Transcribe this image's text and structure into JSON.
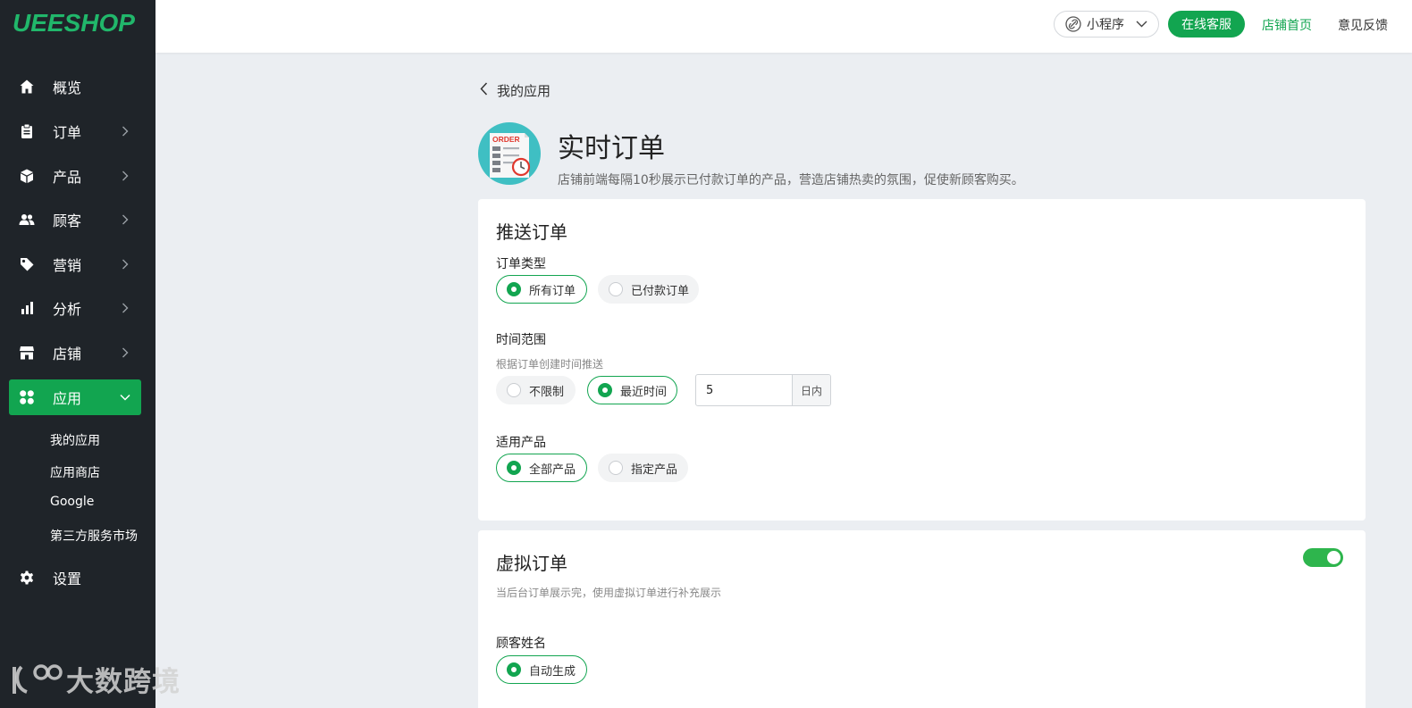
{
  "brand": {
    "logo_text": "UEESHOP",
    "accent": "#12a550"
  },
  "sidebar": {
    "items": [
      {
        "label": "概览",
        "icon": "home-icon",
        "has_chevron": false
      },
      {
        "label": "订单",
        "icon": "clipboard-icon",
        "has_chevron": true
      },
      {
        "label": "产品",
        "icon": "box-icon",
        "has_chevron": true
      },
      {
        "label": "顾客",
        "icon": "users-icon",
        "has_chevron": true
      },
      {
        "label": "营销",
        "icon": "tag-icon",
        "has_chevron": true
      },
      {
        "label": "分析",
        "icon": "bar-chart-icon",
        "has_chevron": true
      },
      {
        "label": "店铺",
        "icon": "store-icon",
        "has_chevron": true
      },
      {
        "label": "应用",
        "icon": "apps-grid-icon",
        "has_chevron": true,
        "active": true,
        "expanded": true
      }
    ],
    "sub_items": [
      {
        "label": "我的应用"
      },
      {
        "label": "应用商店"
      },
      {
        "label": "Google"
      },
      {
        "label": "第三方服务市场"
      }
    ],
    "settings": {
      "label": "设置",
      "icon": "gear-icon"
    }
  },
  "watermark": {
    "text": "大数跨境"
  },
  "topbar": {
    "mini_program": "小程序",
    "online_service": "在线客服",
    "shop_home": "店铺首页",
    "feedback": "意见反馈"
  },
  "header": {
    "back_label": "我的应用",
    "app_icon_text": "ORDER",
    "title": "实时订单",
    "description": "店铺前端每隔10秒展示已付款订单的产品，营造店铺热卖的氛围，促使新顾客购买。"
  },
  "push_orders": {
    "title": "推送订单",
    "order_type": {
      "label": "订单类型",
      "options": [
        {
          "label": "所有订单",
          "selected": true
        },
        {
          "label": "已付款订单",
          "selected": false
        }
      ]
    },
    "time_range": {
      "label": "时间范围",
      "help": "根据订单创建时间推送",
      "options": [
        {
          "label": "不限制",
          "selected": false
        },
        {
          "label": "最近时间",
          "selected": true
        }
      ],
      "days_value": "5",
      "days_suffix": "日内"
    },
    "products": {
      "label": "适用产品",
      "options": [
        {
          "label": "全部产品",
          "selected": true
        },
        {
          "label": "指定产品",
          "selected": false
        }
      ]
    }
  },
  "virtual_orders": {
    "title": "虚拟订单",
    "enabled": true,
    "help": "当后台订单展示完，使用虚拟订单进行补充展示",
    "customer_name": {
      "label": "顾客姓名",
      "options": [
        {
          "label": "自动生成",
          "selected": true
        }
      ]
    }
  }
}
